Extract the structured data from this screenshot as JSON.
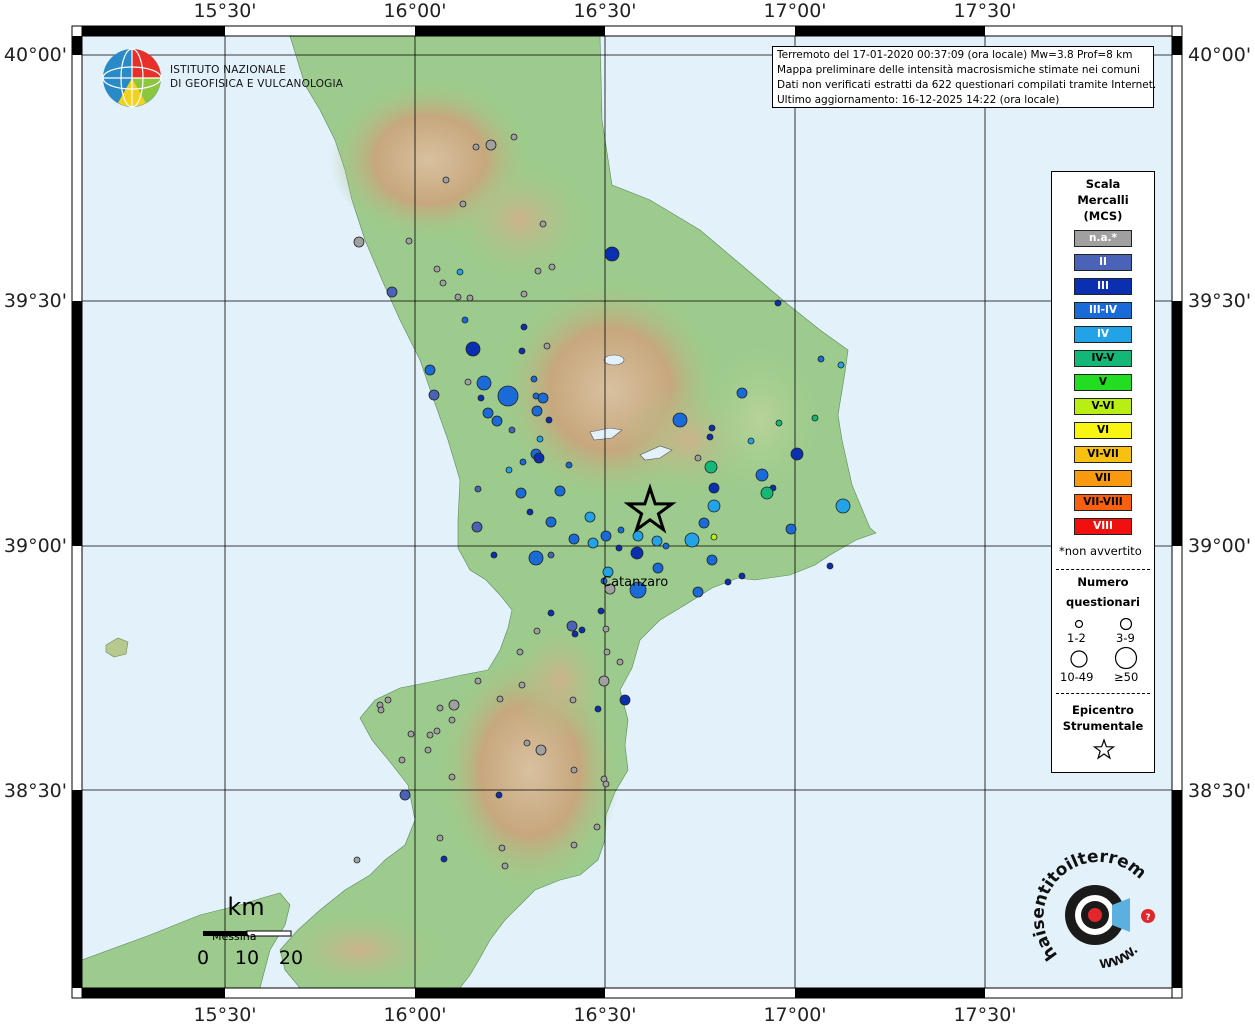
{
  "map": {
    "top_labels": [
      "15°30'",
      "16°00'",
      "16°30'",
      "17°00'",
      "17°30'"
    ],
    "bottom_labels": [
      "15°30'",
      "16°00'",
      "16°30'",
      "17°00'",
      "17°30'"
    ],
    "left_labels": [
      "40°00'",
      "39°30'",
      "39°00'",
      "38°30'"
    ],
    "right_labels": [
      "40°00'",
      "39°30'",
      "39°00'",
      "38°30'"
    ],
    "city_label": "Catanzaro",
    "messina_label": "Messina",
    "colors": {
      "sea": "#e3f1fb",
      "grid": "#000000",
      "land_low": "#8cc98a",
      "land_high": "#c7a77d"
    }
  },
  "info": {
    "line1": "Terremoto del 17-01-2020 00:37:09 (ora locale) Mw=3.8 Prof=8 km",
    "line2": "Mappa preliminare delle intensità macrosismiche stimate nei comuni",
    "line3": "Dati non verificati estratti da 622 questionari compilati tramite Internet.",
    "line4": "Ultimo aggiornamento: 16-12-2025 14:22 (ora locale)"
  },
  "ingv": {
    "line1": "ISTITUTO NAZIONALE",
    "line2": "DI GEOFISICA E VULCANOLOGIA"
  },
  "legend": {
    "title1": "Scala",
    "title2": "Mercalli",
    "title3": "(MCS)",
    "scale": [
      {
        "label": "n.a.*",
        "color": "#a0a0a0",
        "text_color": "#ffffff"
      },
      {
        "label": "II",
        "color": "#4a62b8",
        "text_color": "#ffffff"
      },
      {
        "label": "III",
        "color": "#0a2fb0",
        "text_color": "#ffffff"
      },
      {
        "label": "III-IV",
        "color": "#1a6ad8",
        "text_color": "#ffffff"
      },
      {
        "label": "IV",
        "color": "#22a3e8",
        "text_color": "#ffffff"
      },
      {
        "label": "IV-V",
        "color": "#14b876",
        "text_color": "#000000"
      },
      {
        "label": "V",
        "color": "#22dd22",
        "text_color": "#000000"
      },
      {
        "label": "V-VI",
        "color": "#b8ee12",
        "text_color": "#000000"
      },
      {
        "label": "VI",
        "color": "#f8f512",
        "text_color": "#000000"
      },
      {
        "label": "VI-VII",
        "color": "#f8c010",
        "text_color": "#000000"
      },
      {
        "label": "VII",
        "color": "#f89a10",
        "text_color": "#000000"
      },
      {
        "label": "VII-VIII",
        "color": "#f86010",
        "text_color": "#000000"
      },
      {
        "label": "VIII",
        "color": "#f01010",
        "text_color": "#ffffff"
      }
    ],
    "non_avvertito": "*non avvertito",
    "num_title1": "Numero",
    "num_title2": "questionari",
    "size_labels": [
      "1-2",
      "3-9",
      "10-49",
      "≥50"
    ],
    "epi_title1": "Epicentro",
    "epi_title2": "Strumentale"
  },
  "scalebar": {
    "unit": "km",
    "ticks": [
      "0",
      "10",
      "20"
    ]
  },
  "hsit": {
    "text": "haisentitoilterremoto.it",
    "www": "WWW."
  },
  "epicenter": {
    "lon": 16.62,
    "lat": 39.07
  }
}
